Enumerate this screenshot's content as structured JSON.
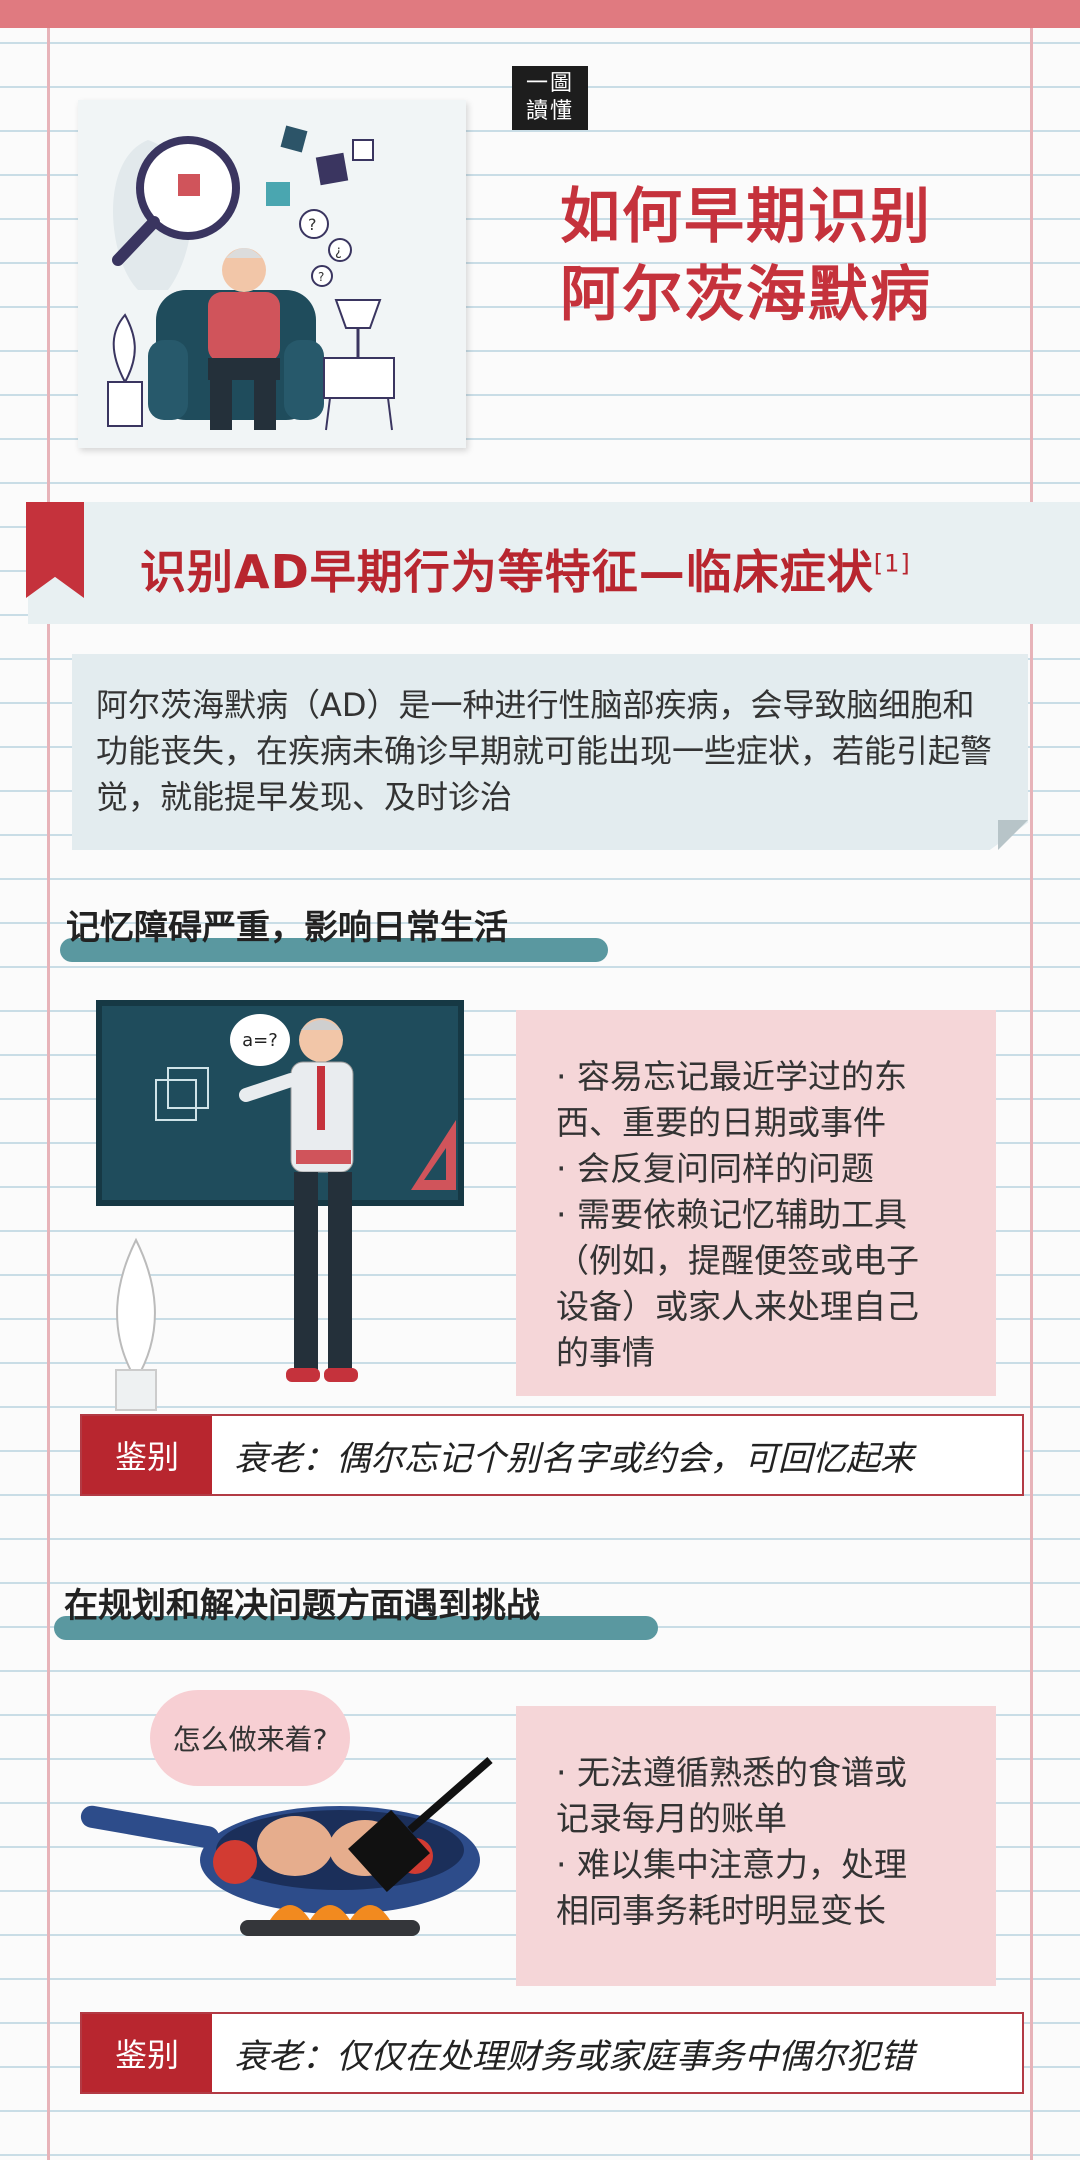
{
  "header": {
    "seal_lines": [
      "一圖",
      "讀懂"
    ],
    "title_line1": "如何早期识别",
    "title_line2": "阿尔茨海默病"
  },
  "section": {
    "title": "识别AD早期行为等特征—临床症状",
    "citation": "[1]",
    "intro": "阿尔茨海默病（AD）是一种进行性脑部疾病，会导致脑细胞和功能丧失，在疾病未确诊早期就可能出现一些症状，若能引起警觉，就能提早发现、及时诊治"
  },
  "items": [
    {
      "heading": "记忆障碍严重，影响日常生活",
      "illustration_text": "a=?",
      "symptom_lines": [
        "· 容易忘记最近学过的东",
        "西、重要的日期或事件",
        "· 会反复问同样的问题",
        "· 需要依赖记忆辅助工具",
        "（例如，提醒便签或电子",
        "设备）或家人来处理自己",
        "的事情"
      ],
      "diff_label": "鉴别",
      "diff_text": "衰老：偶尔忘记个别名字或约会，可回忆起来"
    },
    {
      "heading": "在规划和解决问题方面遇到挑战",
      "illustration_text": "怎么做来着?",
      "symptom_lines": [
        "· 无法遵循熟悉的食谱或",
        "记录每月的账单",
        "· 难以集中注意力，处理",
        "相同事务耗时明显变长"
      ],
      "diff_label": "鉴别",
      "diff_text": "衰老：仅仅在处理财务或家庭事务中偶尔犯错"
    }
  ],
  "colors": {
    "brand_red": "#c5323c",
    "teal": "#5a98a0",
    "pink_panel": "#f5d6d8",
    "intro_panel": "#e3ecef"
  },
  "icons": [
    "bookmark-icon",
    "magnifier-icon",
    "puzzle-icon",
    "teacher-illustration",
    "pan-illustration"
  ]
}
